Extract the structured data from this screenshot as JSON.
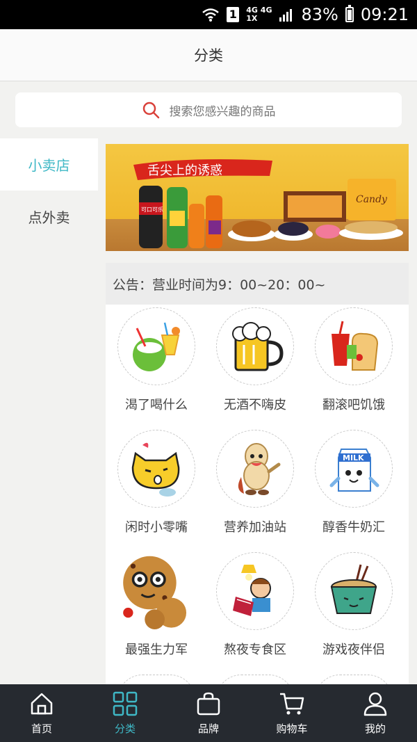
{
  "status_bar": {
    "sim": "1",
    "network_top": "4G 4G",
    "network_bottom": "1X",
    "battery_text": "83%",
    "battery_level": 0.83,
    "time": "09:21"
  },
  "header": {
    "title": "分类"
  },
  "search": {
    "placeholder": "搜索您感兴趣的商品",
    "icon": "search-icon",
    "icon_color": "#d9413a"
  },
  "sidebar": {
    "items": [
      {
        "label": "小卖店",
        "active": true
      },
      {
        "label": "点外卖",
        "active": false
      }
    ]
  },
  "banner": {
    "text": "舌尖上的诱惑",
    "candy_label": "Candy",
    "cola_label": "可口可乐"
  },
  "notice": {
    "text": "公告：营业时间为9：00~20：00~"
  },
  "categories": [
    {
      "label": "渴了喝什么"
    },
    {
      "label": "无酒不嗨皮"
    },
    {
      "label": "翻滚吧饥饿"
    },
    {
      "label": "闲时小零嘴"
    },
    {
      "label": "营养加油站"
    },
    {
      "label": "醇香牛奶汇"
    },
    {
      "label": "最强生力军"
    },
    {
      "label": "熬夜专食区"
    },
    {
      "label": "游戏夜伴侣"
    }
  ],
  "milk_label": "MILK",
  "tabbar": {
    "items": [
      {
        "label": "首页",
        "icon": "home-icon"
      },
      {
        "label": "分类",
        "icon": "grid-icon",
        "active": true
      },
      {
        "label": "品牌",
        "icon": "bag-icon"
      },
      {
        "label": "购物车",
        "icon": "cart-icon"
      },
      {
        "label": "我的",
        "icon": "user-icon"
      }
    ]
  },
  "colors": {
    "accent": "#3fb8c6",
    "tabbar_bg": "#262a30",
    "page_bg": "#f2f2f0"
  }
}
